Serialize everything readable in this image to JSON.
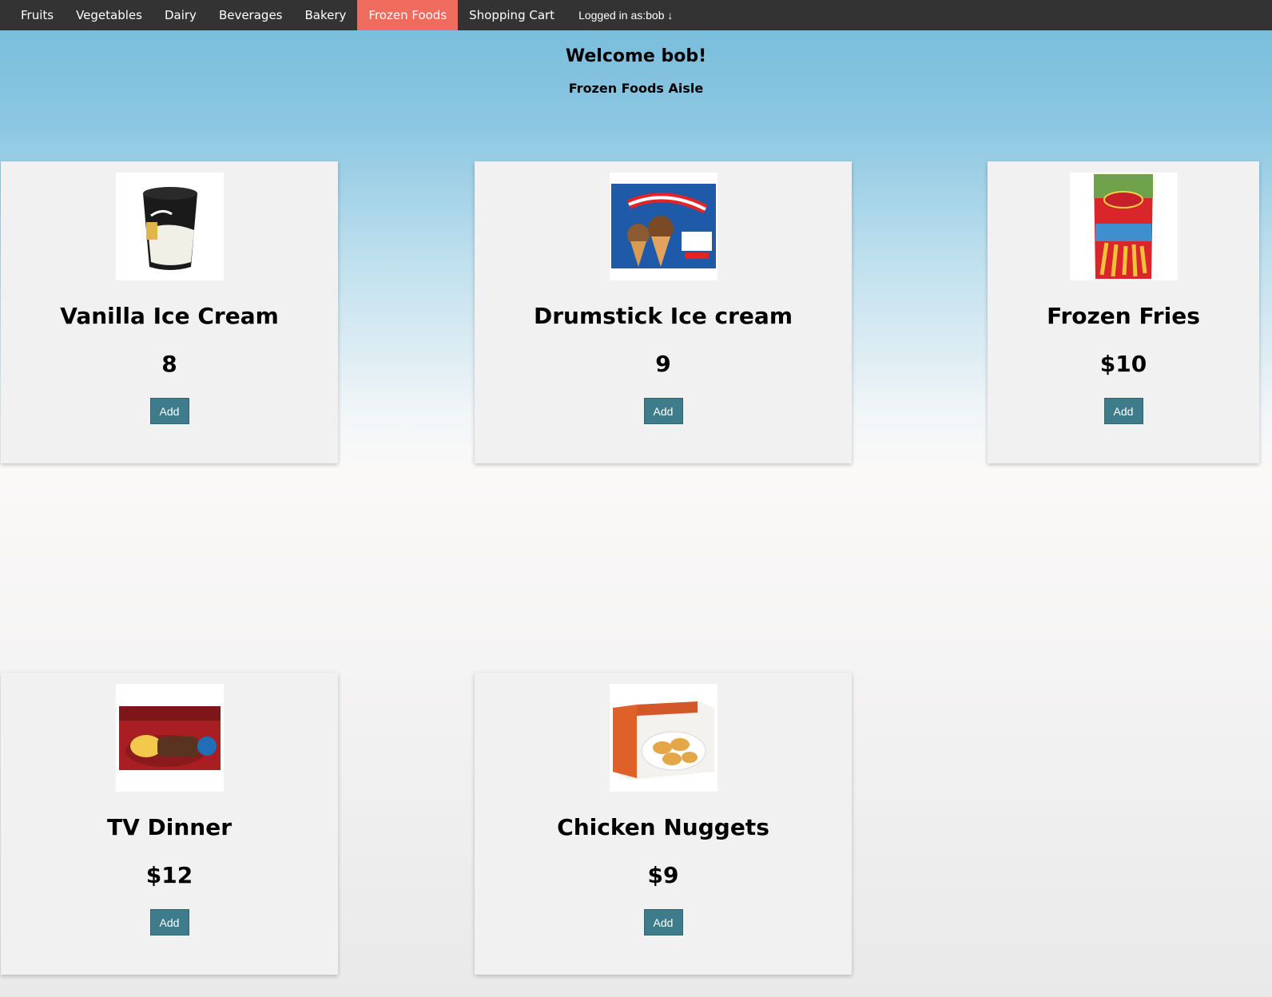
{
  "nav": {
    "items": [
      {
        "label": "Fruits"
      },
      {
        "label": "Vegetables"
      },
      {
        "label": "Dairy"
      },
      {
        "label": "Beverages"
      },
      {
        "label": "Bakery"
      },
      {
        "label": "Frozen Foods"
      },
      {
        "label": "Shopping Cart"
      }
    ],
    "active": "Frozen Foods",
    "active_color": "#ee6b5e",
    "login_text": "Logged in as:bob ↓"
  },
  "header": {
    "welcome": "Welcome bob!",
    "aisle": "Frozen Foods Aisle"
  },
  "products": [
    {
      "name": "Vanilla Ice Cream",
      "price": "8",
      "add_label": "Add",
      "image_icon": "ice-cream-tub-image"
    },
    {
      "name": "Drumstick Ice cream",
      "price": "9",
      "add_label": "Add",
      "image_icon": "drumstick-box-image"
    },
    {
      "name": "Frozen Fries",
      "price": "$10",
      "add_label": "Add",
      "image_icon": "fries-bag-image"
    },
    {
      "name": "TV Dinner",
      "price": "$12",
      "add_label": "Add",
      "image_icon": "tv-dinner-box-image"
    },
    {
      "name": "Chicken Nuggets",
      "price": "$9",
      "add_label": "Add",
      "image_icon": "nuggets-box-image"
    }
  ],
  "colors": {
    "navbar": "#333333",
    "button": "#3e7b8b",
    "card": "#f1f1f1"
  }
}
